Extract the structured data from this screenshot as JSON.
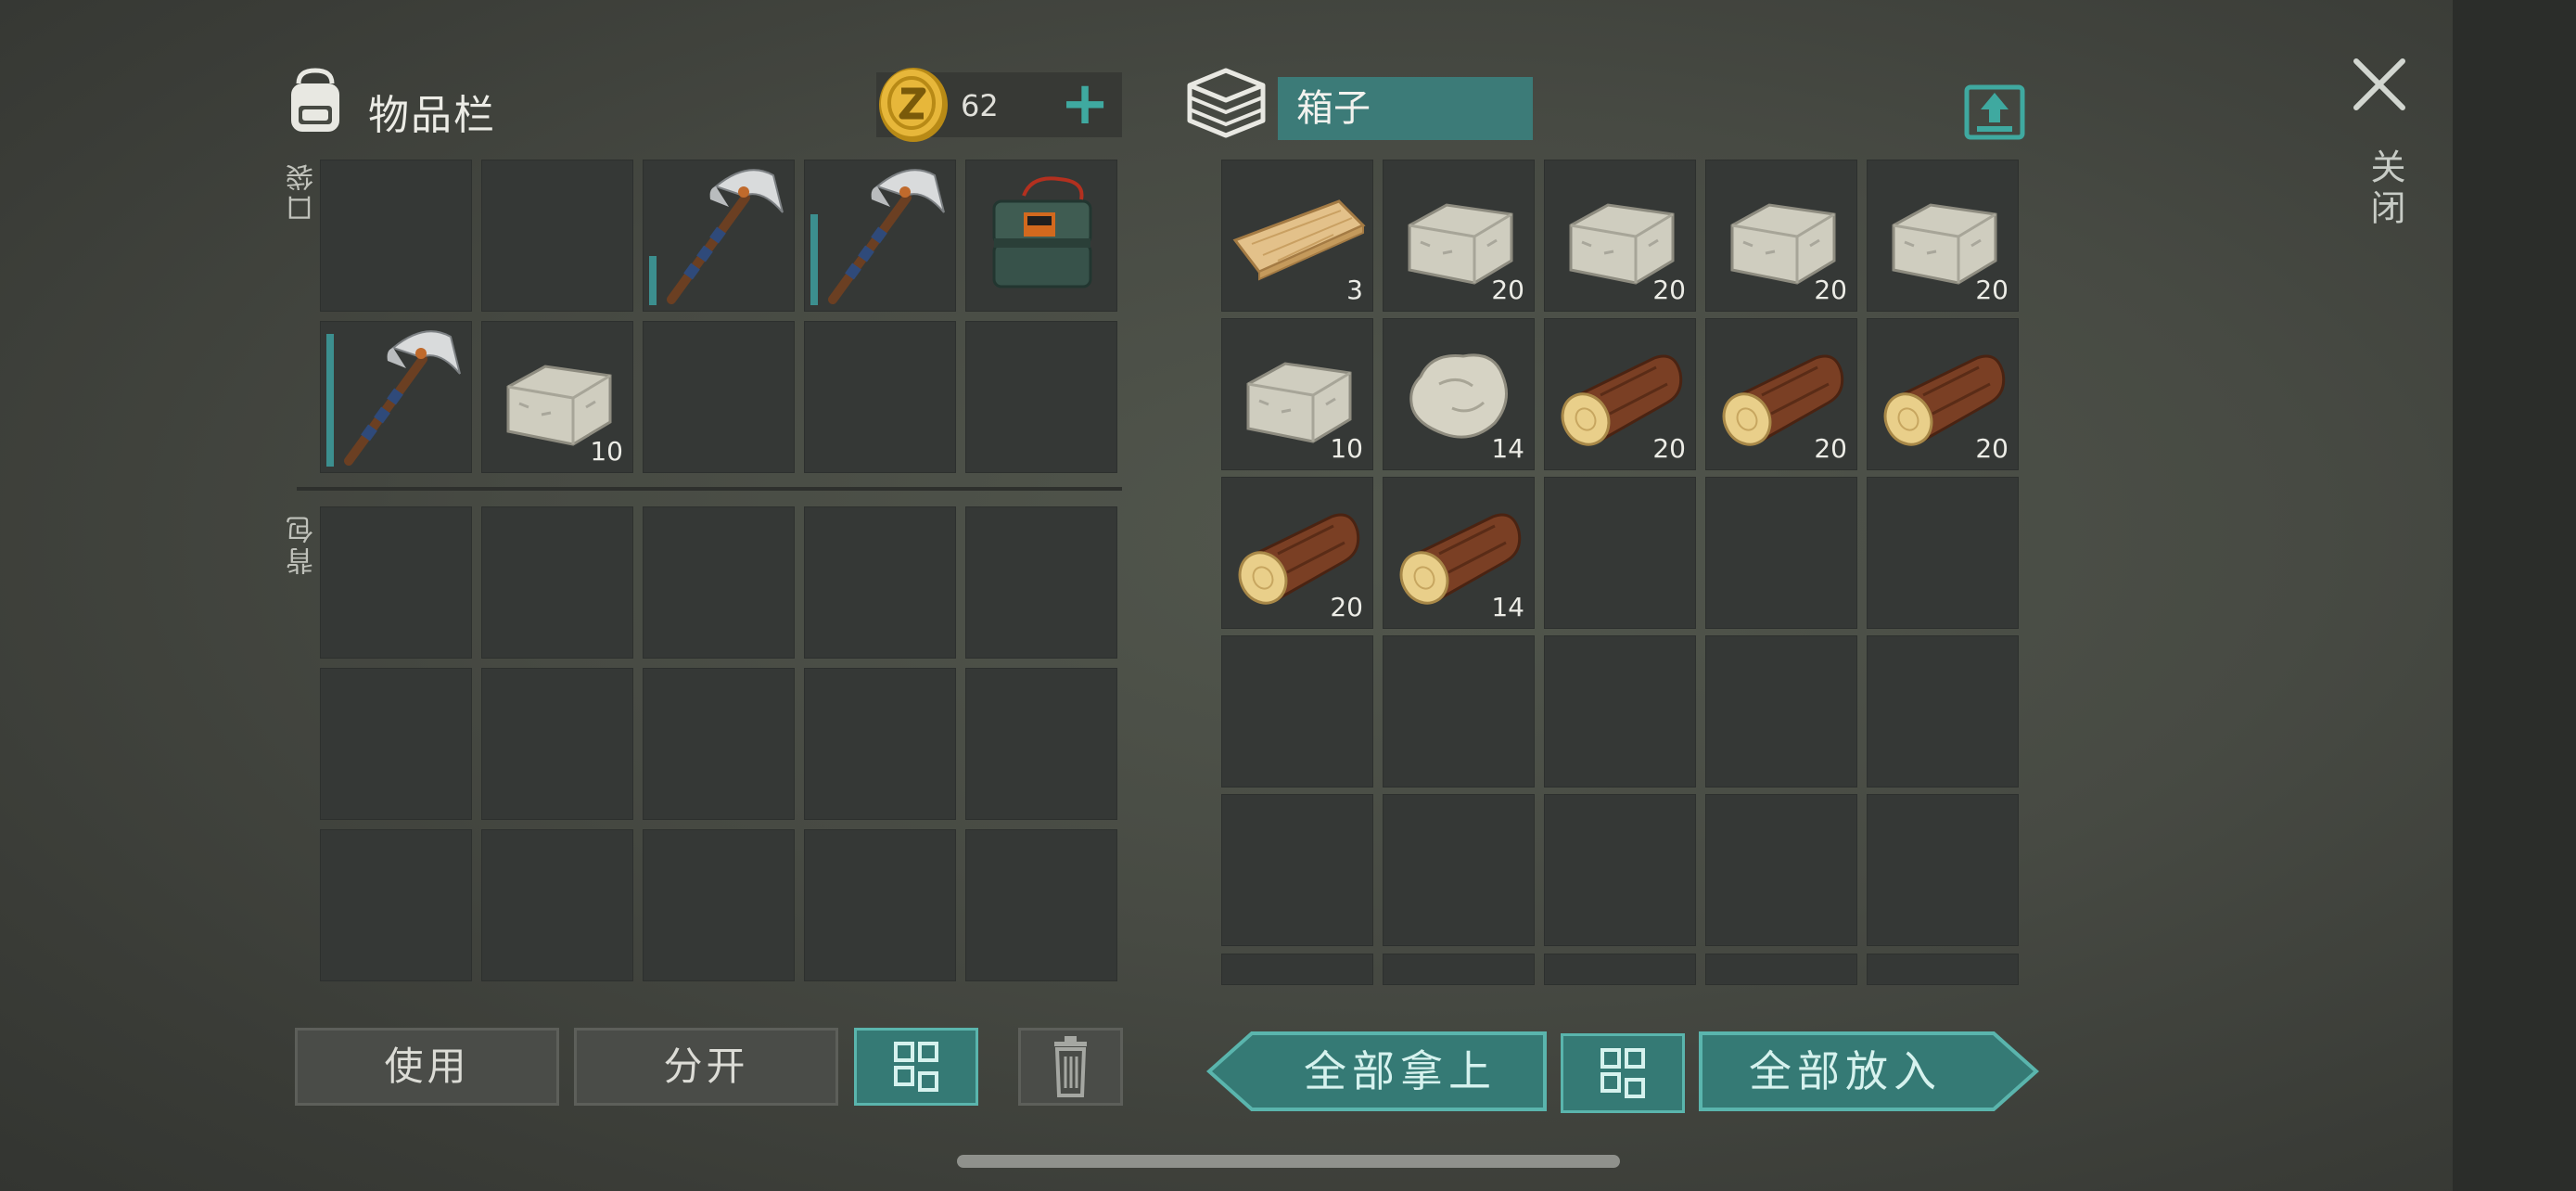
{
  "inventory": {
    "title": "物品栏",
    "coins": "62",
    "plus_label": "+",
    "pocket_label": "口袋",
    "backpack_label": "背包",
    "pocket_slots": [
      {
        "item": "",
        "count": ""
      },
      {
        "item": "",
        "count": ""
      },
      {
        "item": "pickaxe-icon",
        "count": "",
        "durability": 0.35
      },
      {
        "item": "pickaxe-icon",
        "count": "",
        "durability": 0.65
      },
      {
        "item": "c4-icon",
        "count": ""
      },
      {
        "item": "pickaxe-icon",
        "count": "",
        "durability": 0.95
      },
      {
        "item": "stone-block-icon",
        "count": "10"
      },
      {
        "item": "",
        "count": ""
      },
      {
        "item": "",
        "count": ""
      },
      {
        "item": "",
        "count": ""
      }
    ]
  },
  "container": {
    "name": "箱子",
    "slots": [
      {
        "item": "plank-icon",
        "count": "3"
      },
      {
        "item": "stone-block-icon",
        "count": "20"
      },
      {
        "item": "stone-block-icon",
        "count": "20"
      },
      {
        "item": "stone-block-icon",
        "count": "20"
      },
      {
        "item": "stone-block-icon",
        "count": "20"
      },
      {
        "item": "stone-block-icon",
        "count": "10"
      },
      {
        "item": "rock-icon",
        "count": "14"
      },
      {
        "item": "log-icon",
        "count": "20"
      },
      {
        "item": "log-icon",
        "count": "20"
      },
      {
        "item": "log-icon",
        "count": "20"
      },
      {
        "item": "log-icon",
        "count": "20"
      },
      {
        "item": "log-icon",
        "count": "14"
      }
    ]
  },
  "close_label": "关闭",
  "buttons": {
    "use": "使用",
    "split": "分开",
    "take_all": "全部拿上",
    "put_all": "全部放入"
  },
  "colors": {
    "accent_teal": "#3fa9a0",
    "slot_bg": "#353836",
    "durability": "#3c8f8f"
  }
}
